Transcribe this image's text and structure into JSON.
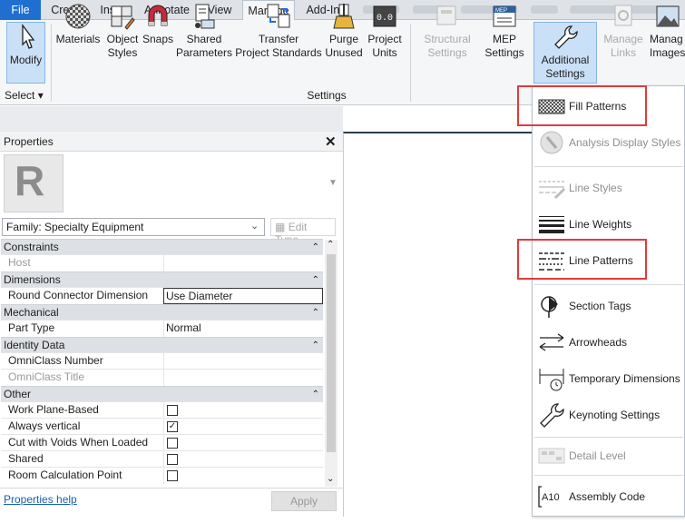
{
  "tabs": [
    "File",
    "Create",
    "Insert",
    "Annotate",
    "View",
    "Manage",
    "Add-Ins"
  ],
  "ribbon": {
    "modify": "Modify",
    "select": "Select",
    "buttons": [
      {
        "label": "Materials"
      },
      {
        "label": "Object\nStyles"
      },
      {
        "label": "Snaps"
      },
      {
        "label": "Shared\nParameters"
      },
      {
        "label": "Transfer\nProject Standards"
      },
      {
        "label": "Purge\nUnused"
      },
      {
        "label": "Project\nUnits"
      },
      {
        "label": "Structural\nSettings"
      },
      {
        "label": "MEP\nSettings"
      },
      {
        "label": "Additional\nSettings"
      },
      {
        "label": "Manage\nLinks"
      },
      {
        "label": "Manag\nImages"
      }
    ],
    "panel_label": "Settings"
  },
  "properties": {
    "title": "Properties",
    "family": "Family: Specialty Equipment",
    "edit_type": "Edit Type",
    "groups": [
      {
        "name": "Constraints"
      },
      {
        "name": "Dimensions"
      },
      {
        "name": "Mechanical"
      },
      {
        "name": "Identity Data"
      },
      {
        "name": "Other"
      }
    ],
    "rows": {
      "host": "Host",
      "round_connector": "Round Connector Dimension",
      "round_connector_val": "Use Diameter",
      "part_type": "Part Type",
      "part_type_val": "Normal",
      "omniclass_number": "OmniClass Number",
      "omniclass_title": "OmniClass Title",
      "work_plane": "Work Plane-Based",
      "always_vertical": "Always vertical",
      "cut_voids": "Cut with Voids When Loaded",
      "shared": "Shared",
      "room_calc": "Room Calculation Point"
    },
    "help": "Properties help",
    "apply": "Apply"
  },
  "menu": {
    "items": [
      {
        "label": "Fill Patterns"
      },
      {
        "label": "Analysis Display Styles"
      },
      {
        "label": "Line Styles"
      },
      {
        "label": "Line Weights"
      },
      {
        "label": "Line Patterns"
      },
      {
        "label": "Section Tags"
      },
      {
        "label": "Arrowheads"
      },
      {
        "label": "Temporary Dimensions"
      },
      {
        "label": "Keynoting Settings"
      },
      {
        "label": "Detail Level"
      },
      {
        "label": "Assembly Code"
      }
    ]
  },
  "colors": {
    "file_tab": "#1f6fd1",
    "highlight": "#e23b3b",
    "group": "#dde0e4"
  }
}
